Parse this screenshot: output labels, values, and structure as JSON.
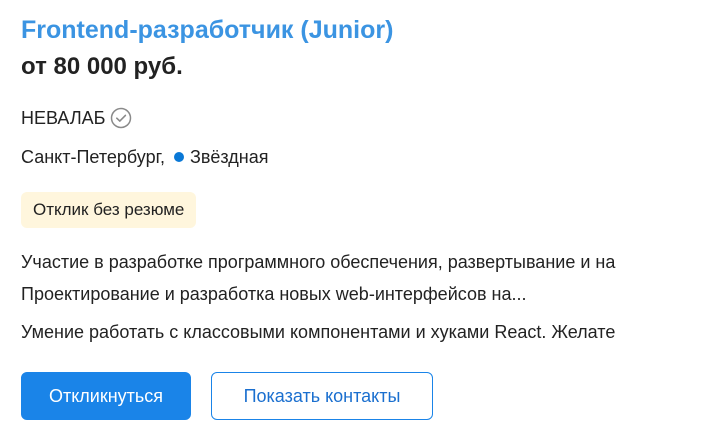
{
  "vacancy": {
    "title": "Frontend-разработчик (Junior)",
    "salary": "от 80 000 руб.",
    "company": "НЕВАЛАБ",
    "company_verified_icon": "verified-check-icon",
    "city": "Санкт-Петербург,",
    "metro": "Звёздная",
    "metro_color": "#0a78d6",
    "badge": "Отклик без резюме",
    "responsibility": "Участие в разработке программного обеспечения, развертывание и на",
    "responsibility_cont": "Проектирование и разработка новых web-интерфейсов на...",
    "requirement": "Умение работать с классовыми компонентами и хуками React. Желате"
  },
  "actions": {
    "respond_label": "Откликнуться",
    "contacts_label": "Показать контакты"
  },
  "colors": {
    "title": "#3b94e2",
    "primary_button": "#1a84e8",
    "badge_bg": "#fff6dd"
  }
}
